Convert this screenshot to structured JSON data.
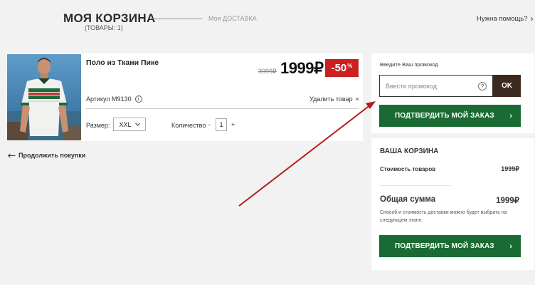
{
  "header": {
    "title": "МОЯ КОРЗИНА",
    "items_count": "(ТОВАРЫ: 1)",
    "next_step": "Моя ДОСТАВКА",
    "help_link": "Нужна помощь?"
  },
  "product": {
    "name": "Поло из Ткани Пике",
    "old_price": "3999₽",
    "new_price": "1999₽",
    "discount": "-50",
    "discount_unit": "%",
    "article_label": "Артикул M9130",
    "remove_label": "Удалить товар",
    "size_label": "Размер:",
    "size_value": "XXL",
    "quantity_label": "Количество",
    "quantity_value": "1",
    "minus": "-",
    "plus": "+"
  },
  "continue_shopping": "Продолжить покупки",
  "promo": {
    "label": "Введите Ваш промокод",
    "placeholder": "Ввести промокод",
    "help": "?",
    "apply_label": "OK",
    "confirm_label": "ПОДТВЕРДИТЬ МОЙ ЗАКАЗ"
  },
  "summary": {
    "title": "ВАША КОРЗИНА",
    "items_cost_label": "Стоимость товаров",
    "items_cost_value": "1999₽",
    "total_label": "Общая сумма",
    "total_value": "1999₽",
    "delivery_note": "Способ и стоимость доставки можно будет выбрать на следующем этапе.",
    "confirm_label": "ПОДТВЕРДИТЬ МОЙ ЗАКАЗ"
  },
  "colors": {
    "primary_button": "#1a6b33",
    "discount_badge": "#cc1f1f",
    "ok_button": "#3d2a1e",
    "annotation_arrow": "#b51c1c"
  },
  "icons": {
    "info": "info-icon",
    "remove": "close-icon",
    "back": "arrow-left-icon",
    "dropdown": "chevron-down-icon",
    "forward": "chevron-right-icon",
    "promo_help": "question-icon"
  }
}
